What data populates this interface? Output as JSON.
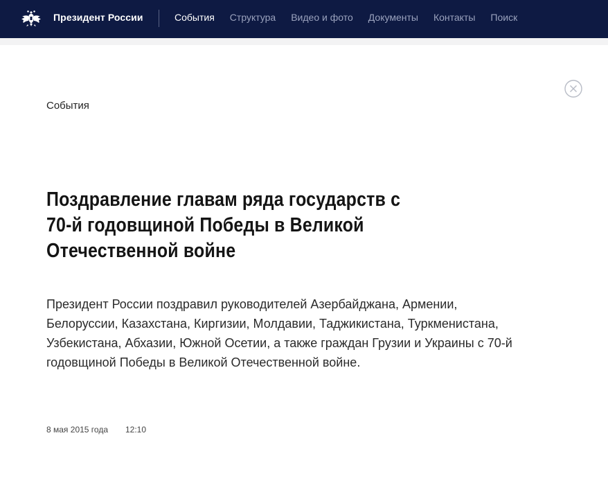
{
  "header": {
    "site_title": "Президент России",
    "nav": [
      {
        "label": "События",
        "active": true
      },
      {
        "label": "Структура",
        "active": false
      },
      {
        "label": "Видео и фото",
        "active": false
      },
      {
        "label": "Документы",
        "active": false
      },
      {
        "label": "Контакты",
        "active": false
      },
      {
        "label": "Поиск",
        "active": false
      }
    ],
    "icons": {
      "emblem": "double-headed-eagle-emblem-icon"
    },
    "colors": {
      "background": "#0e1a43",
      "active": "#ffffff",
      "inactive": "#9aa2bd"
    }
  },
  "article": {
    "section": "События",
    "title": "Поздравление главам ряда государств с 70-й годовщиной Победы в Великой Отечественной войне",
    "lead": "Президент России поздравил руководителей Азербайджана, Армении, Белоруссии, Казахстана, Киргизии, Молдавии, Таджикистана, Туркменистана, Узбекистана, Абхазии, Южной Осетии, а также граждан Грузии и Украины с 70-й годовщиной Победы в Великой Отечественной войне.",
    "date": "8 мая 2015 года",
    "time": "12:10"
  },
  "controls": {
    "close_icon": "close-circle-icon"
  }
}
